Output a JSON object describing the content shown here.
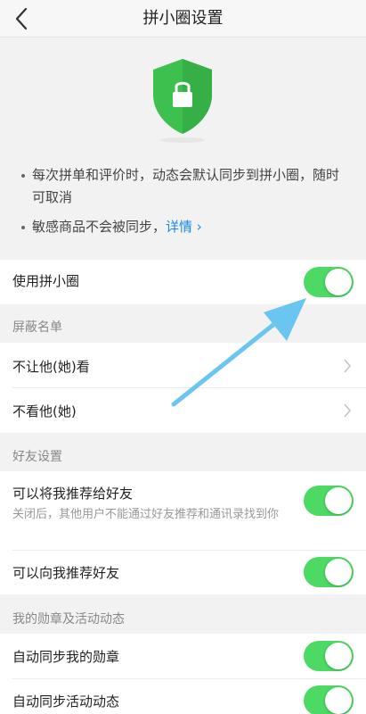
{
  "nav": {
    "title": "拼小圈设置",
    "back_icon": "chevron-left-icon"
  },
  "hero": {
    "icon": "shield-lock-icon",
    "bullets": [
      "每次拼单和评价时，动态会默认同步到拼小圈，随时可取消",
      "敏感商品不会被同步，"
    ],
    "details_link": "详情 ›"
  },
  "use_circle": {
    "label": "使用拼小圈",
    "enabled": true
  },
  "blocklist": {
    "header": "屏蔽名单",
    "items": [
      {
        "label": "不让他(她)看"
      },
      {
        "label": "不看他(她)"
      }
    ]
  },
  "friends": {
    "header": "好友设置",
    "recommend_me": {
      "label": "可以将我推荐给好友",
      "desc": "关闭后，其他用户不能通过好友推荐和通讯录找到你",
      "enabled": true
    },
    "recommend_to_me": {
      "label": "可以向我推荐好友",
      "enabled": true
    }
  },
  "badges": {
    "header": "我的勋章及活动动态",
    "sync_badges": {
      "label": "自动同步我的勋章",
      "enabled": true
    },
    "sync_activity": {
      "label": "自动同步活动动态",
      "enabled": true
    }
  },
  "colors": {
    "toggle_on": "#4cd964",
    "shield": "#3ec04f",
    "link": "#1a88e6",
    "arrow": "#6ac6f0"
  }
}
